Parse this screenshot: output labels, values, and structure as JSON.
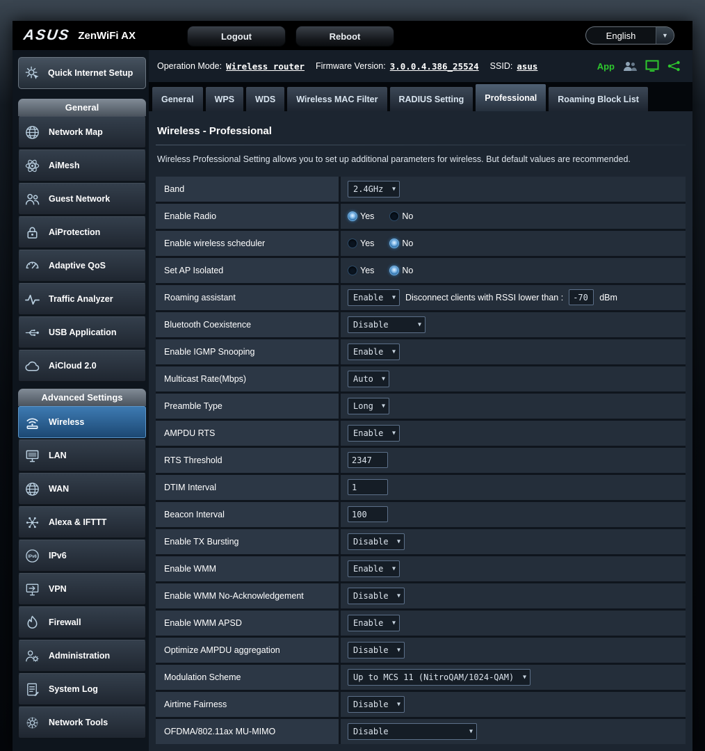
{
  "colors": {
    "app_accent_green": "#2ec72e",
    "active_item_blue": "#2e74b5",
    "radio_selected_blue": "#8cc0ec"
  },
  "header": {
    "brand": "ASUS",
    "product": "ZenWiFi AX",
    "logout_label": "Logout",
    "reboot_label": "Reboot",
    "language_selected": "English"
  },
  "infobar": {
    "operation_mode_label": "Operation Mode:",
    "operation_mode_value": "Wireless router",
    "firmware_label": "Firmware Version:",
    "firmware_value": "3.0.0.4.386_25524",
    "ssid_label": "SSID:",
    "ssid_value": "asus",
    "app_label": "App",
    "icons": [
      "users-icon",
      "remote-screen-icon",
      "network-share-icon"
    ]
  },
  "tabs": {
    "active": "Professional",
    "items": [
      "General",
      "WPS",
      "WDS",
      "Wireless MAC Filter",
      "RADIUS Setting",
      "Professional",
      "Roaming Block List"
    ]
  },
  "sidebar": {
    "qis": {
      "label": "Quick Internet Setup",
      "icon": "quick-setup"
    },
    "sections": [
      {
        "title": "General",
        "items": [
          {
            "label": "Network Map",
            "icon": "network-map"
          },
          {
            "label": "AiMesh",
            "icon": "aimesh"
          },
          {
            "label": "Guest Network",
            "icon": "guest-network"
          },
          {
            "label": "AiProtection",
            "icon": "aiprotection"
          },
          {
            "label": "Adaptive QoS",
            "icon": "adaptive-qos"
          },
          {
            "label": "Traffic Analyzer",
            "icon": "traffic-analyzer"
          },
          {
            "label": "USB Application",
            "icon": "usb-application"
          },
          {
            "label": "AiCloud 2.0",
            "icon": "aicloud"
          }
        ]
      },
      {
        "title": "Advanced Settings",
        "items": [
          {
            "label": "Wireless",
            "icon": "wireless",
            "active": true
          },
          {
            "label": "LAN",
            "icon": "lan"
          },
          {
            "label": "WAN",
            "icon": "wan"
          },
          {
            "label": "Alexa & IFTTT",
            "icon": "alexa-ifttt"
          },
          {
            "label": "IPv6",
            "icon": "ipv6"
          },
          {
            "label": "VPN",
            "icon": "vpn"
          },
          {
            "label": "Firewall",
            "icon": "firewall"
          },
          {
            "label": "Administration",
            "icon": "administration"
          },
          {
            "label": "System Log",
            "icon": "system-log"
          },
          {
            "label": "Network Tools",
            "icon": "network-tools"
          }
        ]
      }
    ]
  },
  "page": {
    "title": "Wireless - Professional",
    "description": "Wireless Professional Setting allows you to set up additional parameters for wireless. But default values are recommended."
  },
  "settings_rows": [
    {
      "label": "Band",
      "type": "select",
      "value": "2.4GHz"
    },
    {
      "label": "Enable Radio",
      "type": "radio",
      "options": [
        "Yes",
        "No"
      ],
      "selected": "Yes"
    },
    {
      "label": "Enable wireless scheduler",
      "type": "radio",
      "options": [
        "Yes",
        "No"
      ],
      "selected": "No"
    },
    {
      "label": "Set AP Isolated",
      "type": "radio",
      "options": [
        "Yes",
        "No"
      ],
      "selected": "No"
    },
    {
      "label": "Roaming assistant",
      "type": "select_with_input",
      "select_value": "Enable",
      "text": "Disconnect clients with RSSI lower than :",
      "input_value": "-70",
      "unit": "dBm"
    },
    {
      "label": "Bluetooth Coexistence",
      "type": "select",
      "value": "Disable"
    },
    {
      "label": "Enable IGMP Snooping",
      "type": "select",
      "value": "Enable"
    },
    {
      "label": "Multicast Rate(Mbps)",
      "type": "select",
      "value": "Auto"
    },
    {
      "label": "Preamble Type",
      "type": "select",
      "value": "Long"
    },
    {
      "label": "AMPDU RTS",
      "type": "select",
      "value": "Enable"
    },
    {
      "label": "RTS Threshold",
      "type": "input",
      "value": "2347"
    },
    {
      "label": "DTIM Interval",
      "type": "input",
      "value": "1"
    },
    {
      "label": "Beacon Interval",
      "type": "input",
      "value": "100"
    },
    {
      "label": "Enable TX Bursting",
      "type": "select",
      "value": "Disable"
    },
    {
      "label": "Enable WMM",
      "type": "select",
      "value": "Enable"
    },
    {
      "label": "Enable WMM No-Acknowledgement",
      "type": "select",
      "value": "Disable"
    },
    {
      "label": "Enable WMM APSD",
      "type": "select",
      "value": "Enable"
    },
    {
      "label": "Optimize AMPDU aggregation",
      "type": "select",
      "value": "Disable"
    },
    {
      "label": "Modulation Scheme",
      "type": "select",
      "value": "Up to MCS 11 (NitroQAM/1024-QAM)"
    },
    {
      "label": "Airtime Fairness",
      "type": "select",
      "value": "Disable"
    },
    {
      "label": "OFDMA/802.11ax MU-MIMO",
      "type": "select",
      "value": "Disable"
    }
  ]
}
